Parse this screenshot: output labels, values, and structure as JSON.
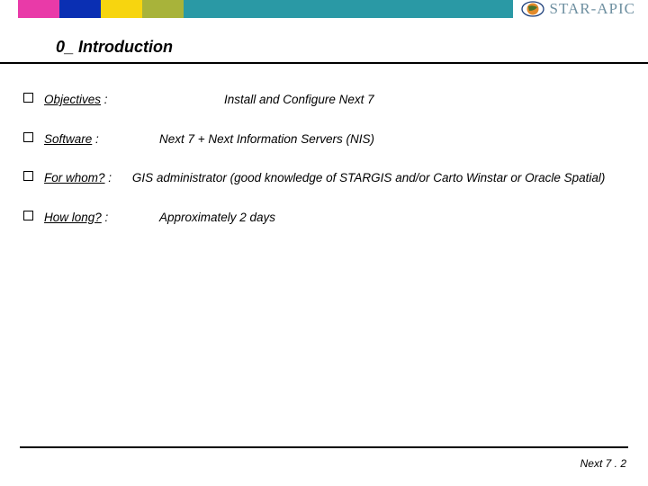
{
  "brand": {
    "name": "STAR-APIC"
  },
  "title": "0_ Introduction",
  "items": [
    {
      "label": "Objectives",
      "colon": " :",
      "value": "Install and Configure Next 7"
    },
    {
      "label": "Software",
      "colon": " :",
      "value": "Next 7 + Next Information Servers (NIS)"
    },
    {
      "label": "For whom?",
      "colon": " :",
      "value": "GIS administrator (good knowledge of STARGIS and/or Carto Winstar or Oracle Spatial)"
    },
    {
      "label": "How long?",
      "colon": " :",
      "value": "Approximately 2 days"
    }
  ],
  "footer": "Next 7 . 2"
}
